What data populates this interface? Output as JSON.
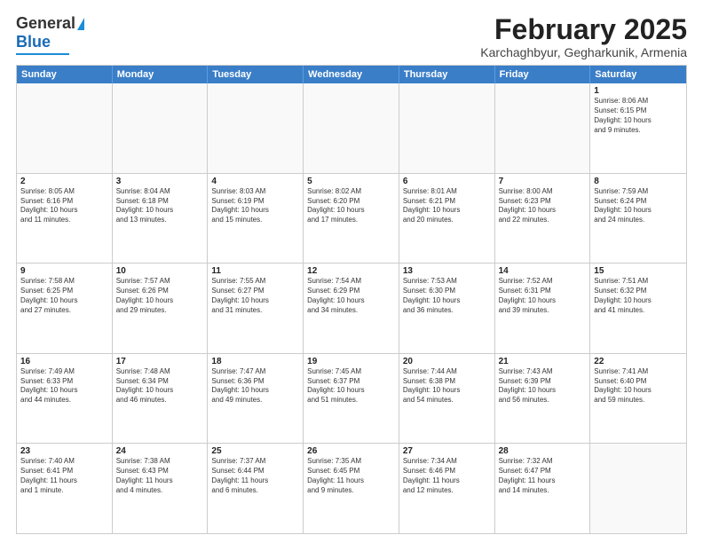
{
  "logo": {
    "line1": "General",
    "line2": "Blue"
  },
  "header": {
    "title": "February 2025",
    "location": "Karchaghbyur, Gegharkunik, Armenia"
  },
  "weekdays": [
    "Sunday",
    "Monday",
    "Tuesday",
    "Wednesday",
    "Thursday",
    "Friday",
    "Saturday"
  ],
  "rows": [
    [
      {
        "day": "",
        "info": ""
      },
      {
        "day": "",
        "info": ""
      },
      {
        "day": "",
        "info": ""
      },
      {
        "day": "",
        "info": ""
      },
      {
        "day": "",
        "info": ""
      },
      {
        "day": "",
        "info": ""
      },
      {
        "day": "1",
        "info": "Sunrise: 8:06 AM\nSunset: 6:15 PM\nDaylight: 10 hours\nand 9 minutes."
      }
    ],
    [
      {
        "day": "2",
        "info": "Sunrise: 8:05 AM\nSunset: 6:16 PM\nDaylight: 10 hours\nand 11 minutes."
      },
      {
        "day": "3",
        "info": "Sunrise: 8:04 AM\nSunset: 6:18 PM\nDaylight: 10 hours\nand 13 minutes."
      },
      {
        "day": "4",
        "info": "Sunrise: 8:03 AM\nSunset: 6:19 PM\nDaylight: 10 hours\nand 15 minutes."
      },
      {
        "day": "5",
        "info": "Sunrise: 8:02 AM\nSunset: 6:20 PM\nDaylight: 10 hours\nand 17 minutes."
      },
      {
        "day": "6",
        "info": "Sunrise: 8:01 AM\nSunset: 6:21 PM\nDaylight: 10 hours\nand 20 minutes."
      },
      {
        "day": "7",
        "info": "Sunrise: 8:00 AM\nSunset: 6:23 PM\nDaylight: 10 hours\nand 22 minutes."
      },
      {
        "day": "8",
        "info": "Sunrise: 7:59 AM\nSunset: 6:24 PM\nDaylight: 10 hours\nand 24 minutes."
      }
    ],
    [
      {
        "day": "9",
        "info": "Sunrise: 7:58 AM\nSunset: 6:25 PM\nDaylight: 10 hours\nand 27 minutes."
      },
      {
        "day": "10",
        "info": "Sunrise: 7:57 AM\nSunset: 6:26 PM\nDaylight: 10 hours\nand 29 minutes."
      },
      {
        "day": "11",
        "info": "Sunrise: 7:55 AM\nSunset: 6:27 PM\nDaylight: 10 hours\nand 31 minutes."
      },
      {
        "day": "12",
        "info": "Sunrise: 7:54 AM\nSunset: 6:29 PM\nDaylight: 10 hours\nand 34 minutes."
      },
      {
        "day": "13",
        "info": "Sunrise: 7:53 AM\nSunset: 6:30 PM\nDaylight: 10 hours\nand 36 minutes."
      },
      {
        "day": "14",
        "info": "Sunrise: 7:52 AM\nSunset: 6:31 PM\nDaylight: 10 hours\nand 39 minutes."
      },
      {
        "day": "15",
        "info": "Sunrise: 7:51 AM\nSunset: 6:32 PM\nDaylight: 10 hours\nand 41 minutes."
      }
    ],
    [
      {
        "day": "16",
        "info": "Sunrise: 7:49 AM\nSunset: 6:33 PM\nDaylight: 10 hours\nand 44 minutes."
      },
      {
        "day": "17",
        "info": "Sunrise: 7:48 AM\nSunset: 6:34 PM\nDaylight: 10 hours\nand 46 minutes."
      },
      {
        "day": "18",
        "info": "Sunrise: 7:47 AM\nSunset: 6:36 PM\nDaylight: 10 hours\nand 49 minutes."
      },
      {
        "day": "19",
        "info": "Sunrise: 7:45 AM\nSunset: 6:37 PM\nDaylight: 10 hours\nand 51 minutes."
      },
      {
        "day": "20",
        "info": "Sunrise: 7:44 AM\nSunset: 6:38 PM\nDaylight: 10 hours\nand 54 minutes."
      },
      {
        "day": "21",
        "info": "Sunrise: 7:43 AM\nSunset: 6:39 PM\nDaylight: 10 hours\nand 56 minutes."
      },
      {
        "day": "22",
        "info": "Sunrise: 7:41 AM\nSunset: 6:40 PM\nDaylight: 10 hours\nand 59 minutes."
      }
    ],
    [
      {
        "day": "23",
        "info": "Sunrise: 7:40 AM\nSunset: 6:41 PM\nDaylight: 11 hours\nand 1 minute."
      },
      {
        "day": "24",
        "info": "Sunrise: 7:38 AM\nSunset: 6:43 PM\nDaylight: 11 hours\nand 4 minutes."
      },
      {
        "day": "25",
        "info": "Sunrise: 7:37 AM\nSunset: 6:44 PM\nDaylight: 11 hours\nand 6 minutes."
      },
      {
        "day": "26",
        "info": "Sunrise: 7:35 AM\nSunset: 6:45 PM\nDaylight: 11 hours\nand 9 minutes."
      },
      {
        "day": "27",
        "info": "Sunrise: 7:34 AM\nSunset: 6:46 PM\nDaylight: 11 hours\nand 12 minutes."
      },
      {
        "day": "28",
        "info": "Sunrise: 7:32 AM\nSunset: 6:47 PM\nDaylight: 11 hours\nand 14 minutes."
      },
      {
        "day": "",
        "info": ""
      }
    ]
  ]
}
